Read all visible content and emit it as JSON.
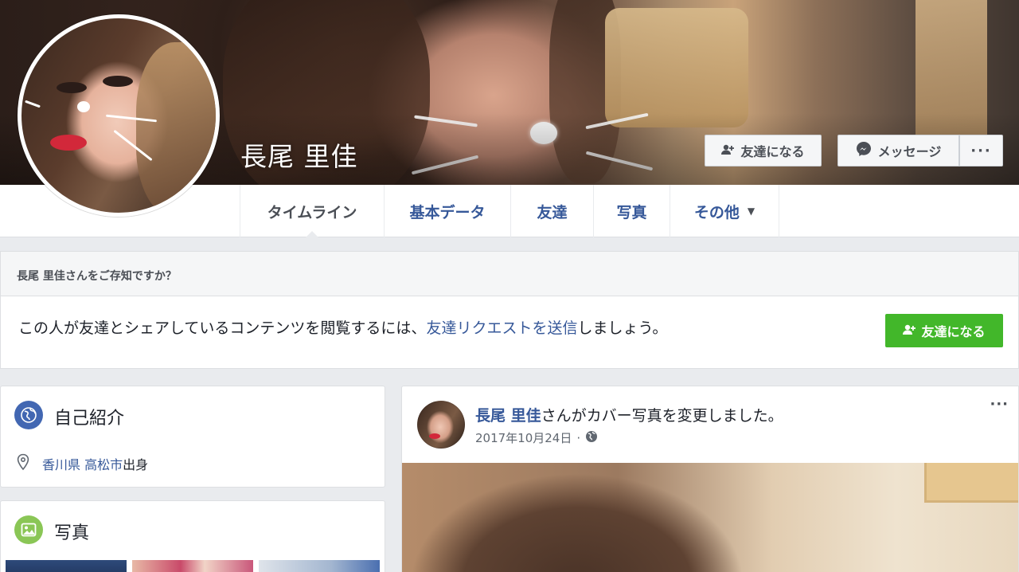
{
  "profile": {
    "name": "長尾 里佳"
  },
  "cover_actions": {
    "add_friend_label": "友達になる",
    "message_label": "メッセージ",
    "more_label": "···"
  },
  "nav": {
    "tabs": [
      {
        "label": "タイムライン",
        "active": true
      },
      {
        "label": "基本データ",
        "active": false
      },
      {
        "label": "友達",
        "active": false
      },
      {
        "label": "写真",
        "active": false
      },
      {
        "label": "その他",
        "active": false,
        "dropdown": true
      }
    ],
    "dropdown_glyph": "▼"
  },
  "know_box": {
    "heading": "長尾 里佳さんをご存知ですか？",
    "text_before": "この人が友達とシェアしているコンテンツを閲覧するには、",
    "link_text": "友達リクエストを送信",
    "text_after": "しましょう。",
    "button_label": "友達になる"
  },
  "intro": {
    "title": "自己紹介",
    "hometown_city": "香川県 高松市",
    "hometown_suffix": "出身"
  },
  "photos": {
    "title": "写真"
  },
  "post": {
    "author": "長尾 里佳",
    "action_text": "さんがカバー写真を変更しました。",
    "date": "2017年10月24日",
    "separator": "·",
    "more_label": "···"
  },
  "colors": {
    "link": "#365899",
    "green_button": "#42b72a",
    "intro_icon": "#4267b2",
    "photos_icon": "#8ac656"
  },
  "icons": {
    "add_friend": "add-friend-icon",
    "messenger": "messenger-icon",
    "globe": "globe-icon",
    "location_pin": "location-pin-icon",
    "photo": "photo-icon",
    "public": "public-globe-icon"
  }
}
